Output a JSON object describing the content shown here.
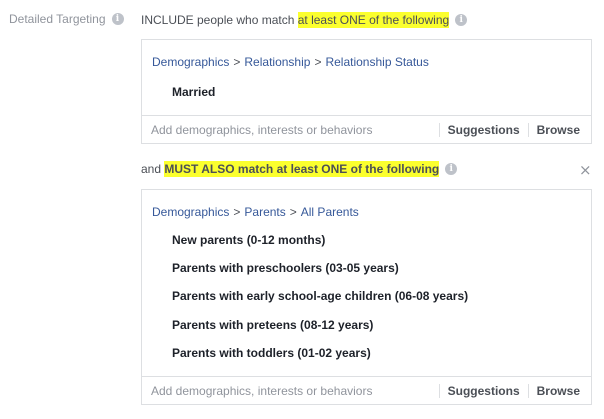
{
  "section_label": "Detailed Targeting",
  "include": {
    "prefix": "INCLUDE people who match ",
    "highlight": "at least ONE of the following",
    "breadcrumb": [
      "Demographics",
      "Relationship",
      "Relationship Status"
    ],
    "items": [
      "Married"
    ],
    "search_placeholder": "Add demographics, interests or behaviors",
    "suggestions_label": "Suggestions",
    "browse_label": "Browse"
  },
  "must": {
    "prefix": "and ",
    "highlight": "MUST ALSO match at least ONE of the following",
    "close_glyph": "×",
    "breadcrumb": [
      "Demographics",
      "Parents",
      "All Parents"
    ],
    "items": [
      "New parents (0-12 months)",
      "Parents with preschoolers (03-05 years)",
      "Parents with early school-age children (06-08 years)",
      "Parents with preteens (08-12 years)",
      "Parents with toddlers (01-02 years)"
    ],
    "search_placeholder": "Add demographics, interests or behaviors",
    "suggestions_label": "Suggestions",
    "browse_label": "Browse"
  },
  "breadcrumb_separator": ">",
  "info_glyph": "i",
  "colors": {
    "highlight": "#fbff2e",
    "link": "#365899",
    "border": "#dddfe2"
  },
  "icons": {
    "info": "info-circle-icon",
    "close": "close-icon"
  }
}
